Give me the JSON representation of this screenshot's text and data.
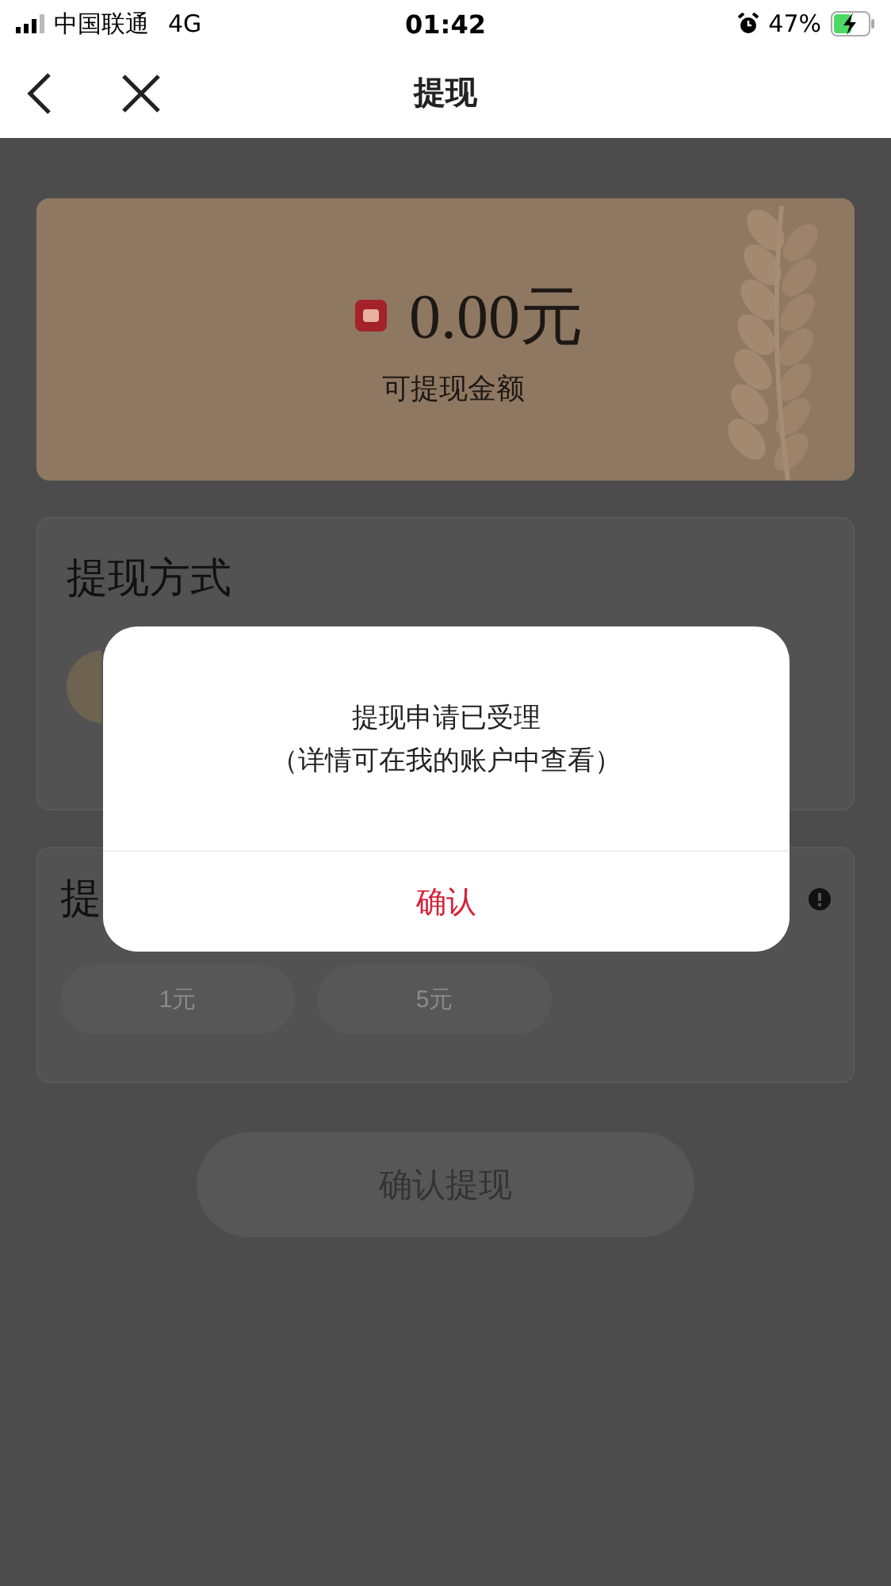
{
  "status_bar": {
    "carrier": "中国联通",
    "network": "4G",
    "time": "01:42",
    "battery": "47%",
    "charging": true
  },
  "nav": {
    "title": "提现"
  },
  "balance": {
    "amount": "0.00元",
    "label": "可提现金额"
  },
  "method_card": {
    "title": "提现方式"
  },
  "amount_card": {
    "title": "提",
    "options": [
      {
        "label": "1元",
        "selected": false
      },
      {
        "label": "5元",
        "selected": false
      }
    ]
  },
  "submit_button": "确认提现",
  "dialog": {
    "lines": [
      "提现申请已受理",
      "（详情可在我的账户中查看）"
    ],
    "button": "确认"
  }
}
